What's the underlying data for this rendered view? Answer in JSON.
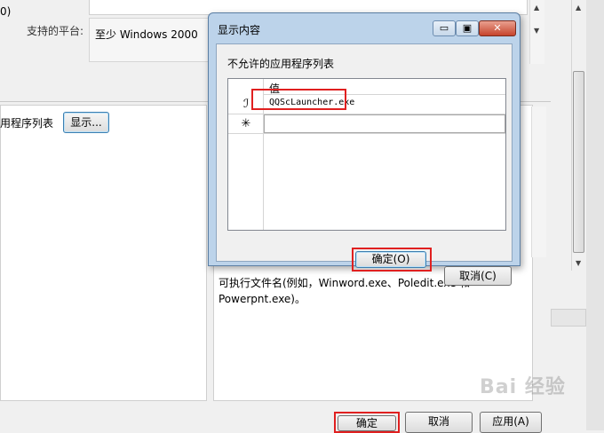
{
  "background": {
    "top_left_fragment": "0)",
    "platform_label": "支持的平台:",
    "platform_value": "至少 Windows 2000",
    "option_label": "用程序列表",
    "show_button": "显示...",
    "description": [
      "可执行文件名(例如，Winword.exe、Poledit.exe 和",
      "Powerpnt.exe)。"
    ],
    "buttons": {
      "ok": "确定",
      "cancel": "取消",
      "apply": "应用(A)"
    },
    "watermark": "Bai 经验"
  },
  "dialog": {
    "title": "显示内容",
    "heading": "不允许的应用程序列表",
    "column_header": "值",
    "rows": [
      {
        "marker": "ℐ",
        "value": "QQScLauncher.exe"
      },
      {
        "marker": "✳",
        "value": ""
      }
    ],
    "ok_button": "确定(O)",
    "cancel_button": "取消(C)",
    "window_controls": {
      "minimize": "▭",
      "maximize": "▣",
      "close": "✕"
    }
  },
  "colors": {
    "highlight": "#e02020",
    "dialog_frame": "#bcd3ea"
  }
}
